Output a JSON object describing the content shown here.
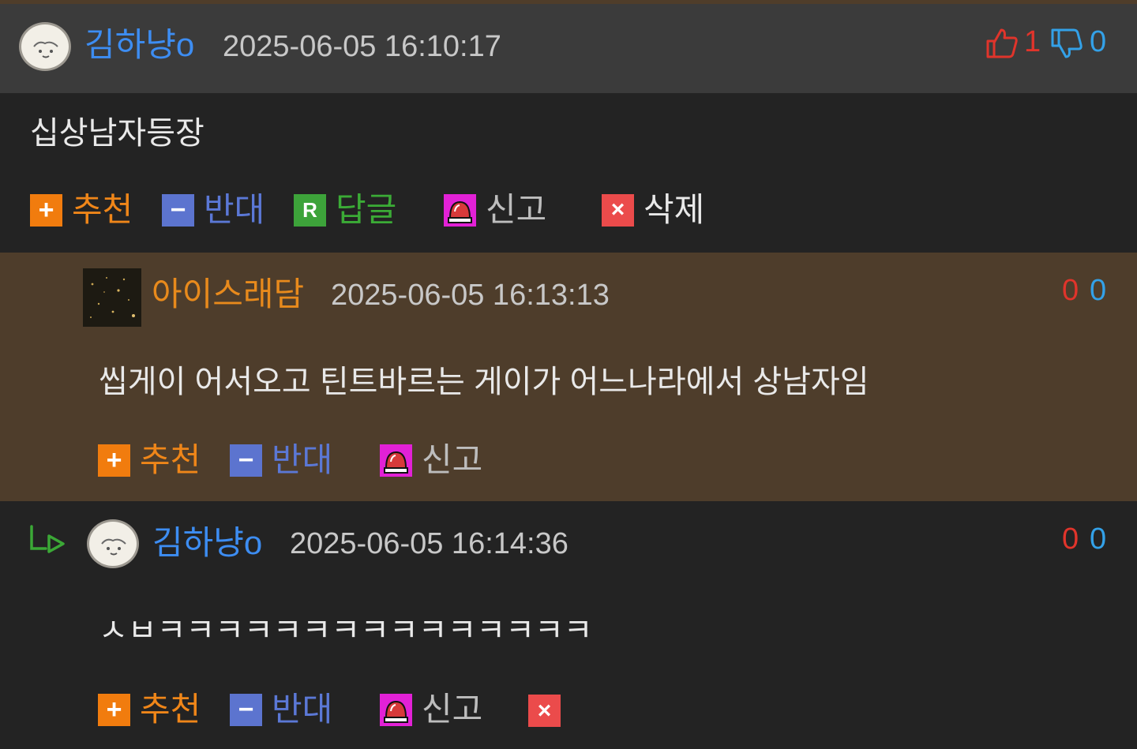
{
  "comments": [
    {
      "username": "김하냥o",
      "timestamp": "2025-06-05 16:10:17",
      "text": "십상남자등장",
      "upvotes": "1",
      "downvotes": "0",
      "actions": {
        "recommend": "추천",
        "oppose": "반대",
        "reply": "답글",
        "report": "신고",
        "delete": "삭제"
      }
    },
    {
      "username": "아이스래담",
      "timestamp": "2025-06-05 16:13:13",
      "text": "씹게이 어서오고 틴트바르는 게이가 어느나라에서 상남자임",
      "upvotes": "0",
      "downvotes": "0",
      "actions": {
        "recommend": "추천",
        "oppose": "반대",
        "report": "신고"
      }
    },
    {
      "username": "김하냥o",
      "timestamp": "2025-06-05 16:14:36",
      "text": "ㅅㅂㅋㅋㅋㅋㅋㅋㅋㅋㅋㅋㅋㅋㅋㅋㅋ",
      "upvotes": "0",
      "downvotes": "0",
      "actions": {
        "recommend": "추천",
        "oppose": "반대",
        "report": "신고"
      }
    }
  ],
  "icons": {
    "thumbs_up": "thumbs-up-icon",
    "thumbs_down": "thumbs-down-icon",
    "plus": "plus-icon",
    "minus": "minus-icon",
    "reply": "reply-icon",
    "report": "siren-icon",
    "delete": "close-icon",
    "reply_arrow": "reply-arrow-icon"
  },
  "colors": {
    "username": "#3d8df2",
    "username_highlight": "#e88a1c",
    "upvote": "#e0342b",
    "downvote": "#33a1e8",
    "recommend": "#f17c0e",
    "oppose": "#5c74cf",
    "reply": "#3da33a",
    "report": "#e221d6",
    "delete": "#eb4b4b",
    "highlight_bg": "#4e3d2b"
  }
}
